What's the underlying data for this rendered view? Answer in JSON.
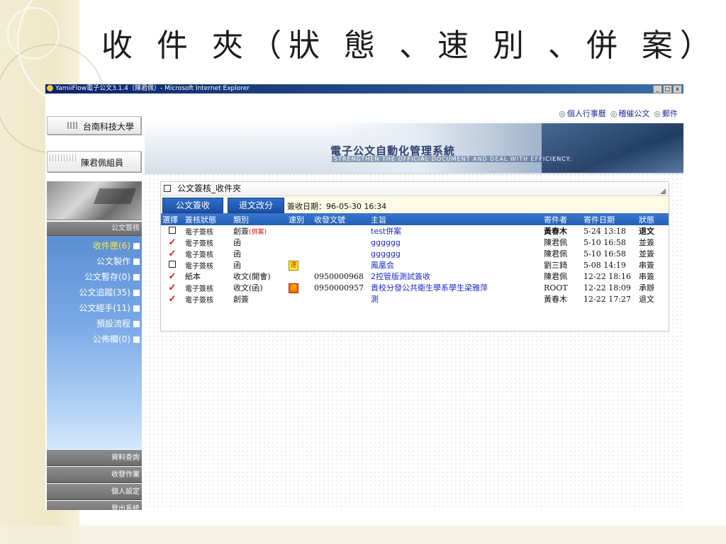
{
  "slide": {
    "title": "收 件 夾（狀 態 、速 別 、併 案）"
  },
  "window": {
    "title": "YamiiFlow電子公文3.1.4（陳君佩）- Microsoft Internet Explorer",
    "min": "_",
    "max": "□",
    "close": "x"
  },
  "header": {
    "school": "台南科技大學",
    "user": "陳君佩組員",
    "links": [
      "個人行事曆",
      "稽催公文",
      "郵件"
    ],
    "banner_title": "電子公文自動化管理系統",
    "banner_sub": "STRENGTHEN THE OFFICIAL DOCUMENT AND DEAL WITH EFFICIENCY."
  },
  "sidebar": {
    "section_top": "公文簽核",
    "items": [
      {
        "label": "收件匣(6)",
        "active": true
      },
      {
        "label": "公文製作",
        "active": false
      },
      {
        "label": "公文暫存(0)",
        "active": false
      },
      {
        "label": "公文追蹤(35)",
        "active": false
      },
      {
        "label": "公文經手(11)",
        "active": false
      },
      {
        "label": "預設流程",
        "active": false
      },
      {
        "label": "公佈欄(0)",
        "active": false
      }
    ],
    "bottom": [
      "資料查詢",
      "收發作業",
      "個人設定",
      "登出系統"
    ]
  },
  "panel": {
    "title": "公文簽核_收件夾",
    "btn_sign": "公文簽收",
    "btn_return": "退文改分",
    "date_label": "簽收日期：96-05-30 16:34",
    "columns": [
      "選擇",
      "簽核狀態",
      "類別",
      "速別",
      "收發文號",
      "主旨",
      "寄件者",
      "寄件日期",
      "狀態"
    ],
    "rows": [
      {
        "sel": "box",
        "sign": "電子簽核",
        "type": "創簽",
        "type_tag": "(併案)",
        "speed": "",
        "no": "",
        "subject": "test併案",
        "sender": "黃春木",
        "date": "5-24 13:18",
        "status": "退文",
        "bold": true
      },
      {
        "sel": "tick",
        "sign": "電子簽核",
        "type": "函",
        "type_tag": "",
        "speed": "",
        "no": "",
        "subject": "gggggg",
        "sender": "陳君佩",
        "date": "5-10 16:58",
        "status": "並簽",
        "bold": false
      },
      {
        "sel": "tick",
        "sign": "電子簽核",
        "type": "函",
        "type_tag": "",
        "speed": "",
        "no": "",
        "subject": "gggggg",
        "sender": "陳君佩",
        "date": "5-10 16:58",
        "status": "並簽",
        "bold": false
      },
      {
        "sel": "box",
        "sign": "電子簽核",
        "type": "函",
        "type_tag": "",
        "speed": "速",
        "speed_color": "yellow",
        "no": "",
        "subject": "鳳凰会",
        "sender": "劉三錡",
        "date": "5-08 14:19",
        "status": "串簽",
        "bold": false
      },
      {
        "sel": "tick",
        "sign": "紙本",
        "type": "收文(開會)",
        "type_tag": "",
        "speed": "",
        "no": "0950000968",
        "subject": "2控管版測試簽收",
        "sender": "陳君佩",
        "date": "12-22 18:16",
        "status": "串簽",
        "bold": false
      },
      {
        "sel": "tick",
        "sign": "電子簽核",
        "type": "收文(函)",
        "type_tag": "",
        "speed": "速",
        "speed_color": "red",
        "no": "0950000957",
        "subject": "貴校分發公共衛生學系學生梁雅萍",
        "sender": "ROOT",
        "date": "12-22 18:09",
        "status": "承辦",
        "bold": false
      },
      {
        "sel": "tick",
        "sign": "電子簽核",
        "type": "創簽",
        "type_tag": "",
        "speed": "",
        "no": "",
        "subject": "測",
        "sender": "黃春木",
        "date": "12-22 17:27",
        "status": "退文",
        "bold": false
      }
    ]
  }
}
